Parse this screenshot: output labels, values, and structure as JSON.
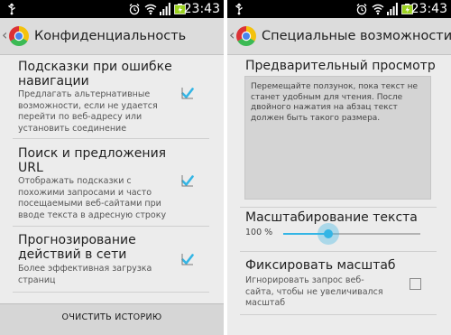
{
  "status_bar": {
    "time": "23:43",
    "icons": [
      "usb-icon",
      "alarm-icon",
      "wifi-icon",
      "signal-icon",
      "battery-charging-icon"
    ]
  },
  "left_screen": {
    "title": "Конфиденциальность",
    "items": [
      {
        "title_lines": [
          "Подсказки при ошибке",
          "навигации"
        ],
        "summary_lines": [
          "Предлагать альтернативные",
          "возможности, если не удается",
          "перейти по веб-адресу или",
          "установить соединение"
        ],
        "checked": true
      },
      {
        "title_lines": [
          "Поиск и предложения",
          "URL"
        ],
        "summary_lines": [
          "Отображать подсказки с",
          "похожими запросами и часто",
          "посещаемыми веб-сайтами при",
          "вводе текста в адресную строку"
        ],
        "checked": true
      },
      {
        "title_lines": [
          "Прогнозирование",
          "действий в сети"
        ],
        "summary_lines": [
          "Более эффективная загрузка",
          "страниц"
        ],
        "checked": true
      }
    ],
    "clear_button": "ОЧИСТИТЬ ИСТОРИЮ"
  },
  "right_screen": {
    "title": "Специальные возможности",
    "preview": {
      "title": "Предварительный просмотр",
      "text_lines": [
        "Перемещайте ползунок, пока текст не",
        "станет удобным для чтения. После",
        "двойного нажатия на абзац текст",
        "должен быть такого размера."
      ]
    },
    "text_scale": {
      "title": "Масштабирование текста",
      "value_label": "100 %",
      "slider_fraction": 0.33
    },
    "force_zoom": {
      "title": "Фиксировать масштаб",
      "summary_lines": [
        "Игнорировать запрос веб-",
        "сайта, чтобы не увеличивался",
        "масштаб"
      ],
      "checked": false
    }
  },
  "colors": {
    "accent": "#33b5e5",
    "status_bar": "#000000",
    "background": "#ececec"
  }
}
